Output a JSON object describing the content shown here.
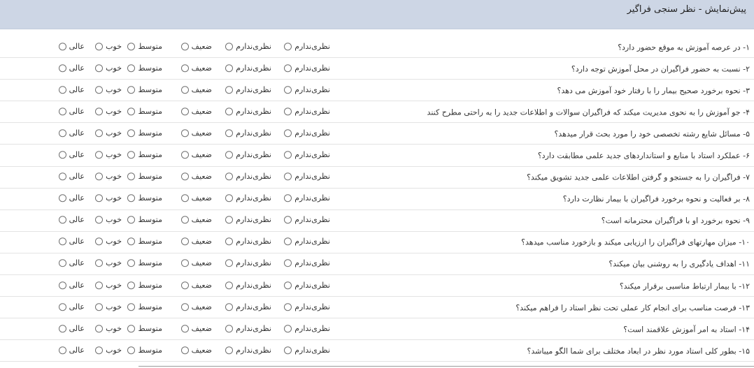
{
  "header": {
    "title": "پیش‌نمایش - نظر سنجی فراگیر"
  },
  "options": [
    "نظری‌ندارم",
    "نظری‌ندارم",
    "ضعیف",
    "متوسط",
    "خوب",
    "عالی"
  ],
  "questions": [
    "۱- در عرصه آموزش به موقع حضور دارد؟",
    "۲- نسبت به حضور فراگیران در محل آموزش توجه دارد؟",
    "۳- نحوه برخورد صحیح بیمار را با رفتار خود آموزش می دهد؟",
    "۴- جو آموزش را به نحوی مدیریت میکند که فراگیران سوالات و اطلاعات جدید را به راحتی مطرح کنند",
    "۵- مسائل شایع رشته تخصصی خود را مورد بحث قرار میدهد؟",
    "۶- عملکرد استاد با منابع و استانداردهای جدید علمی مطابقت دارد؟",
    "۷- فراگیران را به جستجو و گرفتن اطلاعات علمی جدید تشویق میکند؟",
    "۸- بر فعالیت و نحوه برخورد فراگیران با بیمار نظارت دارد؟",
    "۹- نحوه برخورد او با فراگیران محترمانه است؟",
    "۱۰- میزان مهارتهای فراگیران را ارزیابی میکند و بازخورد مناسب میدهد؟",
    "۱۱- اهداف یادگیری را به روشنی بیان میکند؟",
    "۱۲- با بیمار ارتباط مناسبی برقرار میکند؟",
    "۱۳- فرصت مناسب برای انجام کار عملی تحت نظر استاد را فراهم میکند؟",
    "۱۴- استاد به امر آموزش علاقمند است؟",
    "۱۵- بطور کلی استاد مورد نظر در ابعاد مختلف برای شما الگو میباشد؟"
  ]
}
